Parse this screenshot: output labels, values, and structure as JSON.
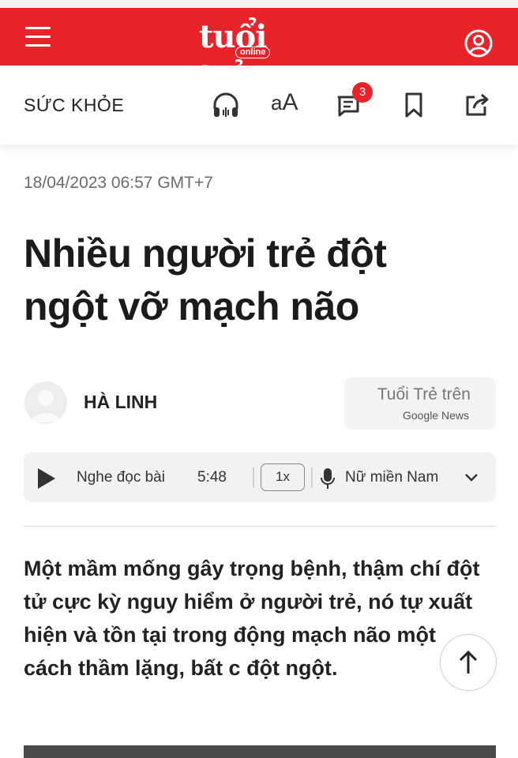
{
  "header": {
    "logo_main": "tuổi trẻ",
    "logo_sub": "online",
    "brand_color": "#e8232a"
  },
  "toolbar": {
    "section": "SỨC KHỎE",
    "font_size_label_small": "a",
    "font_size_label_large": "A",
    "comment_count": "3",
    "icons": [
      "headphones-icon",
      "font-size-icon",
      "comment-icon",
      "bookmark-icon",
      "share-icon"
    ]
  },
  "article": {
    "timestamp": "18/04/2023 06:57 GMT+7",
    "headline_line1": "Nhiều người trẻ đột",
    "headline_line2": "ngột vỡ mạch não",
    "author": "HÀ LINH",
    "lead": "Một mầm mống gây trọng bệnh, thậm chí đột tử cực kỳ nguy hiểm ở người trẻ, nó tự xuất hiện và tồn tại trong động mạch não một cách thầm lặng, bất c đột ngột."
  },
  "google_news": {
    "line1": "Tuổi Trẻ trên",
    "line2": "Google News"
  },
  "player": {
    "listen_label": "Nghe đọc bài",
    "duration": "5:48",
    "speed": "1x",
    "voice": "Nữ miền Nam"
  }
}
